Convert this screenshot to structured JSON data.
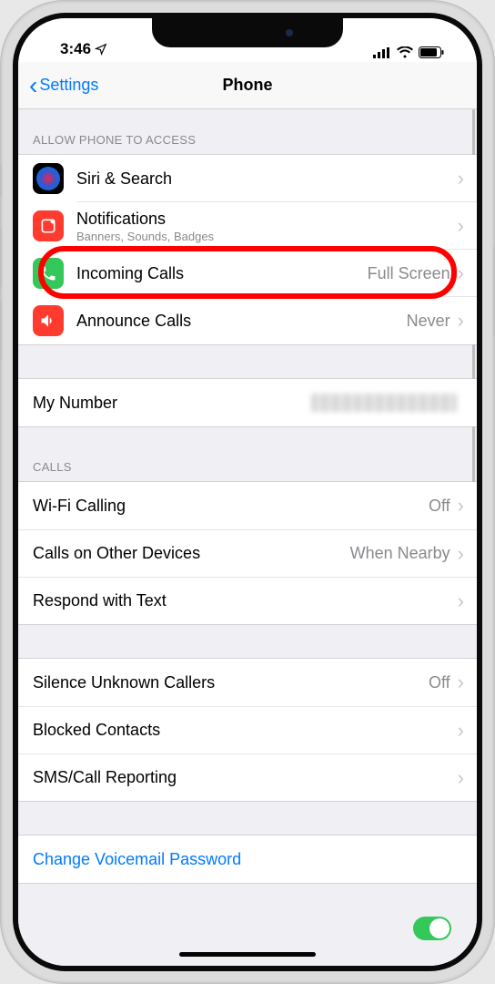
{
  "status": {
    "time": "3:46"
  },
  "nav": {
    "back": "Settings",
    "title": "Phone"
  },
  "sections": {
    "access_header": "ALLOW PHONE TO ACCESS",
    "calls_header": "CALLS"
  },
  "access": {
    "siri": {
      "title": "Siri & Search"
    },
    "notifications": {
      "title": "Notifications",
      "subtitle": "Banners, Sounds, Badges"
    },
    "incoming": {
      "title": "Incoming Calls",
      "value": "Full Screen"
    },
    "announce": {
      "title": "Announce Calls",
      "value": "Never"
    }
  },
  "my_number": {
    "title": "My Number"
  },
  "calls": {
    "wifi": {
      "title": "Wi-Fi Calling",
      "value": "Off"
    },
    "other": {
      "title": "Calls on Other Devices",
      "value": "When Nearby"
    },
    "respond": {
      "title": "Respond with Text"
    }
  },
  "more": {
    "silence": {
      "title": "Silence Unknown Callers",
      "value": "Off"
    },
    "blocked": {
      "title": "Blocked Contacts"
    },
    "sms": {
      "title": "SMS/Call Reporting"
    }
  },
  "voicemail": {
    "title": "Change Voicemail Password"
  }
}
